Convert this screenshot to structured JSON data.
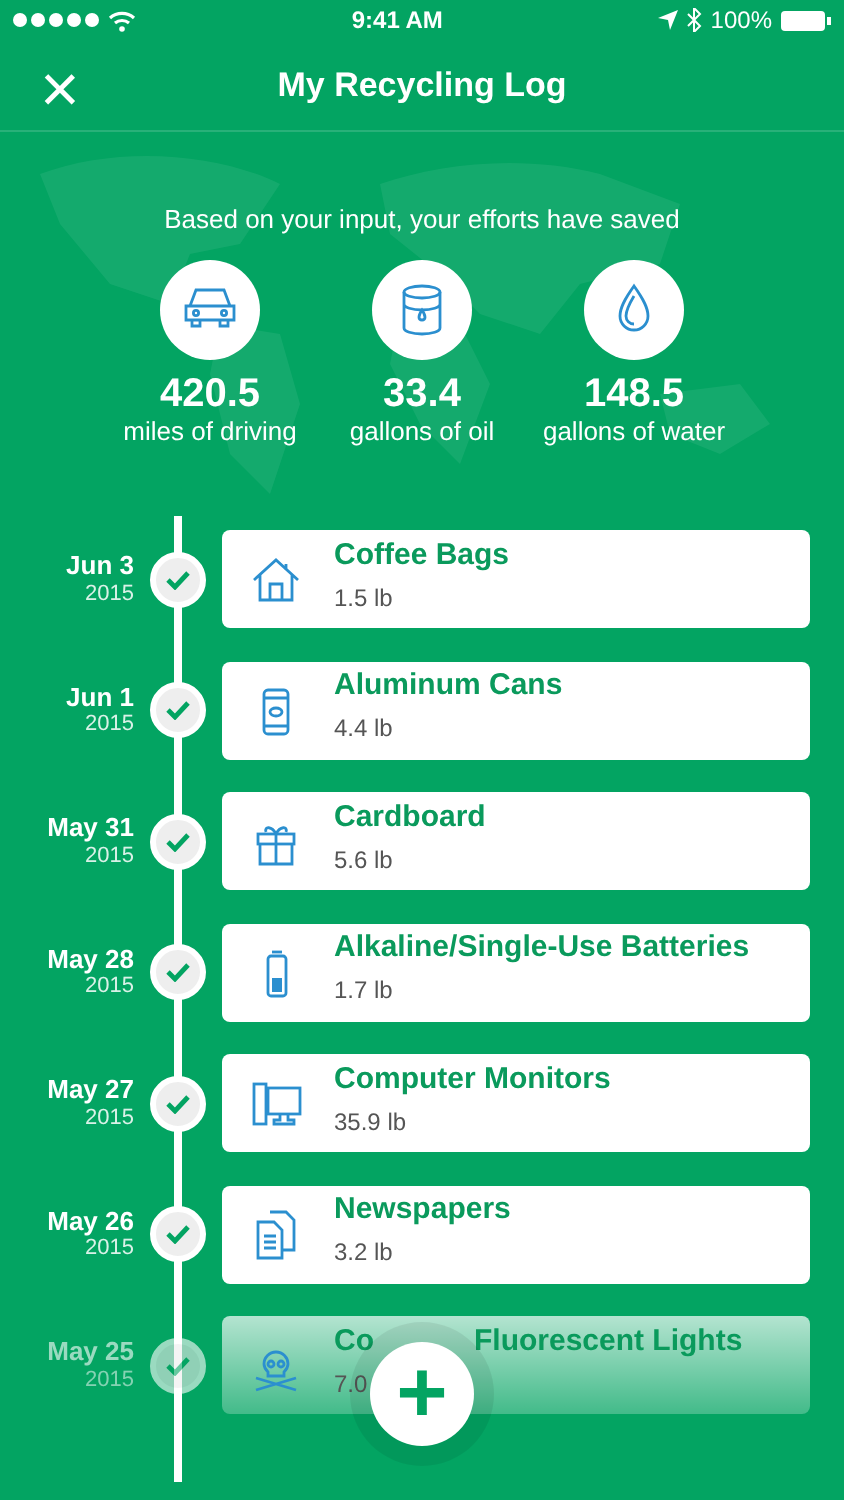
{
  "status_bar": {
    "time": "9:41 AM",
    "battery": "100%"
  },
  "nav": {
    "title": "My Recycling Log",
    "close": "×"
  },
  "summary": {
    "intro": "Based on your input, your efforts have saved",
    "stats": [
      {
        "value": "420.5",
        "label": "miles of driving"
      },
      {
        "value": "33.4",
        "label": "gallons of oil"
      },
      {
        "value": "148.5",
        "label": "gallons of water"
      }
    ]
  },
  "log": [
    {
      "date": "Jun 3",
      "year": "2015",
      "name_parts": [
        "Coffee Bags"
      ],
      "weight": "1.5 lb",
      "faded": false
    },
    {
      "date": "Jun 1",
      "year": "2015",
      "name_parts": [
        "Aluminum Cans"
      ],
      "weight": "4.4 lb",
      "faded": false
    },
    {
      "date": "May 31",
      "year": "2015",
      "name_parts": [
        "Cardboard"
      ],
      "weight": "5.6 lb",
      "faded": false
    },
    {
      "date": "May 28",
      "year": "2015",
      "name_parts": [
        "Alkaline/Single-Use Batteries"
      ],
      "weight": "1.7 lb",
      "faded": false
    },
    {
      "date": "May 27",
      "year": "2015",
      "name_parts": [
        "Computer Monitors"
      ],
      "weight": "35.9 lb",
      "faded": false
    },
    {
      "date": "May 26",
      "year": "2015",
      "name_parts": [
        "Newspapers"
      ],
      "weight": "3.2 lb",
      "faded": false
    },
    {
      "date": "May 25",
      "year": "2015",
      "name_parts": [
        "Co",
        "Fluorescent Lights"
      ],
      "weight": "7.0",
      "faded": true
    }
  ],
  "add_button": {
    "label": "+"
  }
}
